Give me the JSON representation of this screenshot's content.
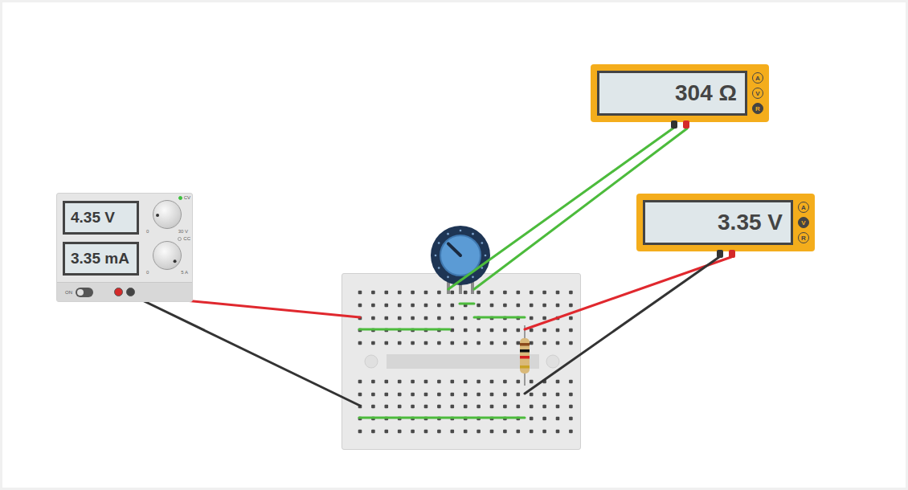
{
  "power_supply": {
    "on": true,
    "switch_label": "ON",
    "readouts": [
      {
        "value": "4.35 V",
        "knob_level": 0.15,
        "scale_min": "0",
        "scale_max": "30 V",
        "indicator": "CV",
        "lit": true
      },
      {
        "value": "3.35 mA",
        "knob_level": 0.97,
        "scale_min": "0",
        "scale_max": "5 A",
        "indicator": "CC",
        "lit": false
      }
    ]
  },
  "multimeters": [
    {
      "reading": "304 Ω",
      "modes": [
        {
          "label": "A",
          "selected": false
        },
        {
          "label": "V",
          "selected": false
        },
        {
          "label": "R",
          "selected": true
        }
      ]
    },
    {
      "reading": "3.35 V",
      "modes": [
        {
          "label": "A",
          "selected": false
        },
        {
          "label": "V",
          "selected": true
        },
        {
          "label": "R",
          "selected": false
        }
      ]
    }
  ],
  "potentiometer": {
    "level": 0.33
  },
  "resistor": {
    "bands": [
      {
        "color": "#8b4a1c"
      },
      {
        "color": "#111111"
      },
      {
        "color": "#d42020"
      },
      {
        "color": "#c9a227"
      }
    ]
  },
  "wires": [
    {
      "color": "#e0282e"
    },
    {
      "color": "#333333"
    },
    {
      "color": "#4cbb3c"
    },
    {
      "color": "#4cbb3c"
    },
    {
      "color": "#4cbb3c"
    },
    {
      "color": "#4cbb3c"
    },
    {
      "color": "#4cbb3c"
    },
    {
      "color": "#4cbb3c"
    },
    {
      "color": "#e0282e"
    },
    {
      "color": "#333333"
    }
  ]
}
